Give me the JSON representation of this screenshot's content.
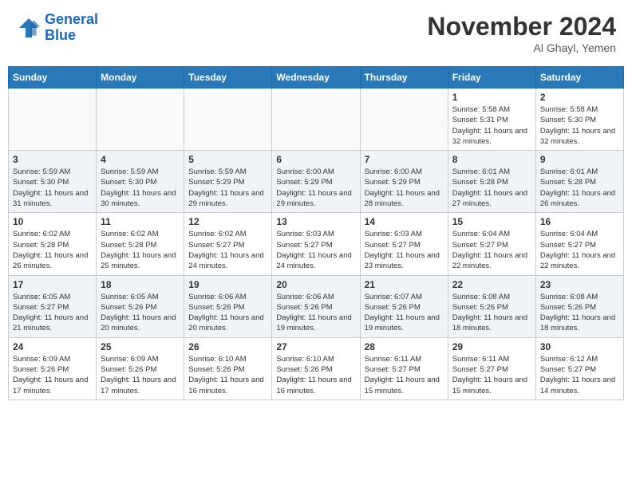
{
  "header": {
    "logo_line1": "General",
    "logo_line2": "Blue",
    "month": "November 2024",
    "location": "Al Ghayl, Yemen"
  },
  "weekdays": [
    "Sunday",
    "Monday",
    "Tuesday",
    "Wednesday",
    "Thursday",
    "Friday",
    "Saturday"
  ],
  "weeks": [
    [
      {
        "day": "",
        "sunrise": "",
        "sunset": "",
        "daylight": ""
      },
      {
        "day": "",
        "sunrise": "",
        "sunset": "",
        "daylight": ""
      },
      {
        "day": "",
        "sunrise": "",
        "sunset": "",
        "daylight": ""
      },
      {
        "day": "",
        "sunrise": "",
        "sunset": "",
        "daylight": ""
      },
      {
        "day": "",
        "sunrise": "",
        "sunset": "",
        "daylight": ""
      },
      {
        "day": "1",
        "sunrise": "Sunrise: 5:58 AM",
        "sunset": "Sunset: 5:31 PM",
        "daylight": "Daylight: 11 hours and 32 minutes."
      },
      {
        "day": "2",
        "sunrise": "Sunrise: 5:58 AM",
        "sunset": "Sunset: 5:30 PM",
        "daylight": "Daylight: 11 hours and 32 minutes."
      }
    ],
    [
      {
        "day": "3",
        "sunrise": "Sunrise: 5:59 AM",
        "sunset": "Sunset: 5:30 PM",
        "daylight": "Daylight: 11 hours and 31 minutes."
      },
      {
        "day": "4",
        "sunrise": "Sunrise: 5:59 AM",
        "sunset": "Sunset: 5:30 PM",
        "daylight": "Daylight: 11 hours and 30 minutes."
      },
      {
        "day": "5",
        "sunrise": "Sunrise: 5:59 AM",
        "sunset": "Sunset: 5:29 PM",
        "daylight": "Daylight: 11 hours and 29 minutes."
      },
      {
        "day": "6",
        "sunrise": "Sunrise: 6:00 AM",
        "sunset": "Sunset: 5:29 PM",
        "daylight": "Daylight: 11 hours and 29 minutes."
      },
      {
        "day": "7",
        "sunrise": "Sunrise: 6:00 AM",
        "sunset": "Sunset: 5:29 PM",
        "daylight": "Daylight: 11 hours and 28 minutes."
      },
      {
        "day": "8",
        "sunrise": "Sunrise: 6:01 AM",
        "sunset": "Sunset: 5:28 PM",
        "daylight": "Daylight: 11 hours and 27 minutes."
      },
      {
        "day": "9",
        "sunrise": "Sunrise: 6:01 AM",
        "sunset": "Sunset: 5:28 PM",
        "daylight": "Daylight: 11 hours and 26 minutes."
      }
    ],
    [
      {
        "day": "10",
        "sunrise": "Sunrise: 6:02 AM",
        "sunset": "Sunset: 5:28 PM",
        "daylight": "Daylight: 11 hours and 26 minutes."
      },
      {
        "day": "11",
        "sunrise": "Sunrise: 6:02 AM",
        "sunset": "Sunset: 5:28 PM",
        "daylight": "Daylight: 11 hours and 25 minutes."
      },
      {
        "day": "12",
        "sunrise": "Sunrise: 6:02 AM",
        "sunset": "Sunset: 5:27 PM",
        "daylight": "Daylight: 11 hours and 24 minutes."
      },
      {
        "day": "13",
        "sunrise": "Sunrise: 6:03 AM",
        "sunset": "Sunset: 5:27 PM",
        "daylight": "Daylight: 11 hours and 24 minutes."
      },
      {
        "day": "14",
        "sunrise": "Sunrise: 6:03 AM",
        "sunset": "Sunset: 5:27 PM",
        "daylight": "Daylight: 11 hours and 23 minutes."
      },
      {
        "day": "15",
        "sunrise": "Sunrise: 6:04 AM",
        "sunset": "Sunset: 5:27 PM",
        "daylight": "Daylight: 11 hours and 22 minutes."
      },
      {
        "day": "16",
        "sunrise": "Sunrise: 6:04 AM",
        "sunset": "Sunset: 5:27 PM",
        "daylight": "Daylight: 11 hours and 22 minutes."
      }
    ],
    [
      {
        "day": "17",
        "sunrise": "Sunrise: 6:05 AM",
        "sunset": "Sunset: 5:27 PM",
        "daylight": "Daylight: 11 hours and 21 minutes."
      },
      {
        "day": "18",
        "sunrise": "Sunrise: 6:05 AM",
        "sunset": "Sunset: 5:26 PM",
        "daylight": "Daylight: 11 hours and 20 minutes."
      },
      {
        "day": "19",
        "sunrise": "Sunrise: 6:06 AM",
        "sunset": "Sunset: 5:26 PM",
        "daylight": "Daylight: 11 hours and 20 minutes."
      },
      {
        "day": "20",
        "sunrise": "Sunrise: 6:06 AM",
        "sunset": "Sunset: 5:26 PM",
        "daylight": "Daylight: 11 hours and 19 minutes."
      },
      {
        "day": "21",
        "sunrise": "Sunrise: 6:07 AM",
        "sunset": "Sunset: 5:26 PM",
        "daylight": "Daylight: 11 hours and 19 minutes."
      },
      {
        "day": "22",
        "sunrise": "Sunrise: 6:08 AM",
        "sunset": "Sunset: 5:26 PM",
        "daylight": "Daylight: 11 hours and 18 minutes."
      },
      {
        "day": "23",
        "sunrise": "Sunrise: 6:08 AM",
        "sunset": "Sunset: 5:26 PM",
        "daylight": "Daylight: 11 hours and 18 minutes."
      }
    ],
    [
      {
        "day": "24",
        "sunrise": "Sunrise: 6:09 AM",
        "sunset": "Sunset: 5:26 PM",
        "daylight": "Daylight: 11 hours and 17 minutes."
      },
      {
        "day": "25",
        "sunrise": "Sunrise: 6:09 AM",
        "sunset": "Sunset: 5:26 PM",
        "daylight": "Daylight: 11 hours and 17 minutes."
      },
      {
        "day": "26",
        "sunrise": "Sunrise: 6:10 AM",
        "sunset": "Sunset: 5:26 PM",
        "daylight": "Daylight: 11 hours and 16 minutes."
      },
      {
        "day": "27",
        "sunrise": "Sunrise: 6:10 AM",
        "sunset": "Sunset: 5:26 PM",
        "daylight": "Daylight: 11 hours and 16 minutes."
      },
      {
        "day": "28",
        "sunrise": "Sunrise: 6:11 AM",
        "sunset": "Sunset: 5:27 PM",
        "daylight": "Daylight: 11 hours and 15 minutes."
      },
      {
        "day": "29",
        "sunrise": "Sunrise: 6:11 AM",
        "sunset": "Sunset: 5:27 PM",
        "daylight": "Daylight: 11 hours and 15 minutes."
      },
      {
        "day": "30",
        "sunrise": "Sunrise: 6:12 AM",
        "sunset": "Sunset: 5:27 PM",
        "daylight": "Daylight: 11 hours and 14 minutes."
      }
    ]
  ]
}
